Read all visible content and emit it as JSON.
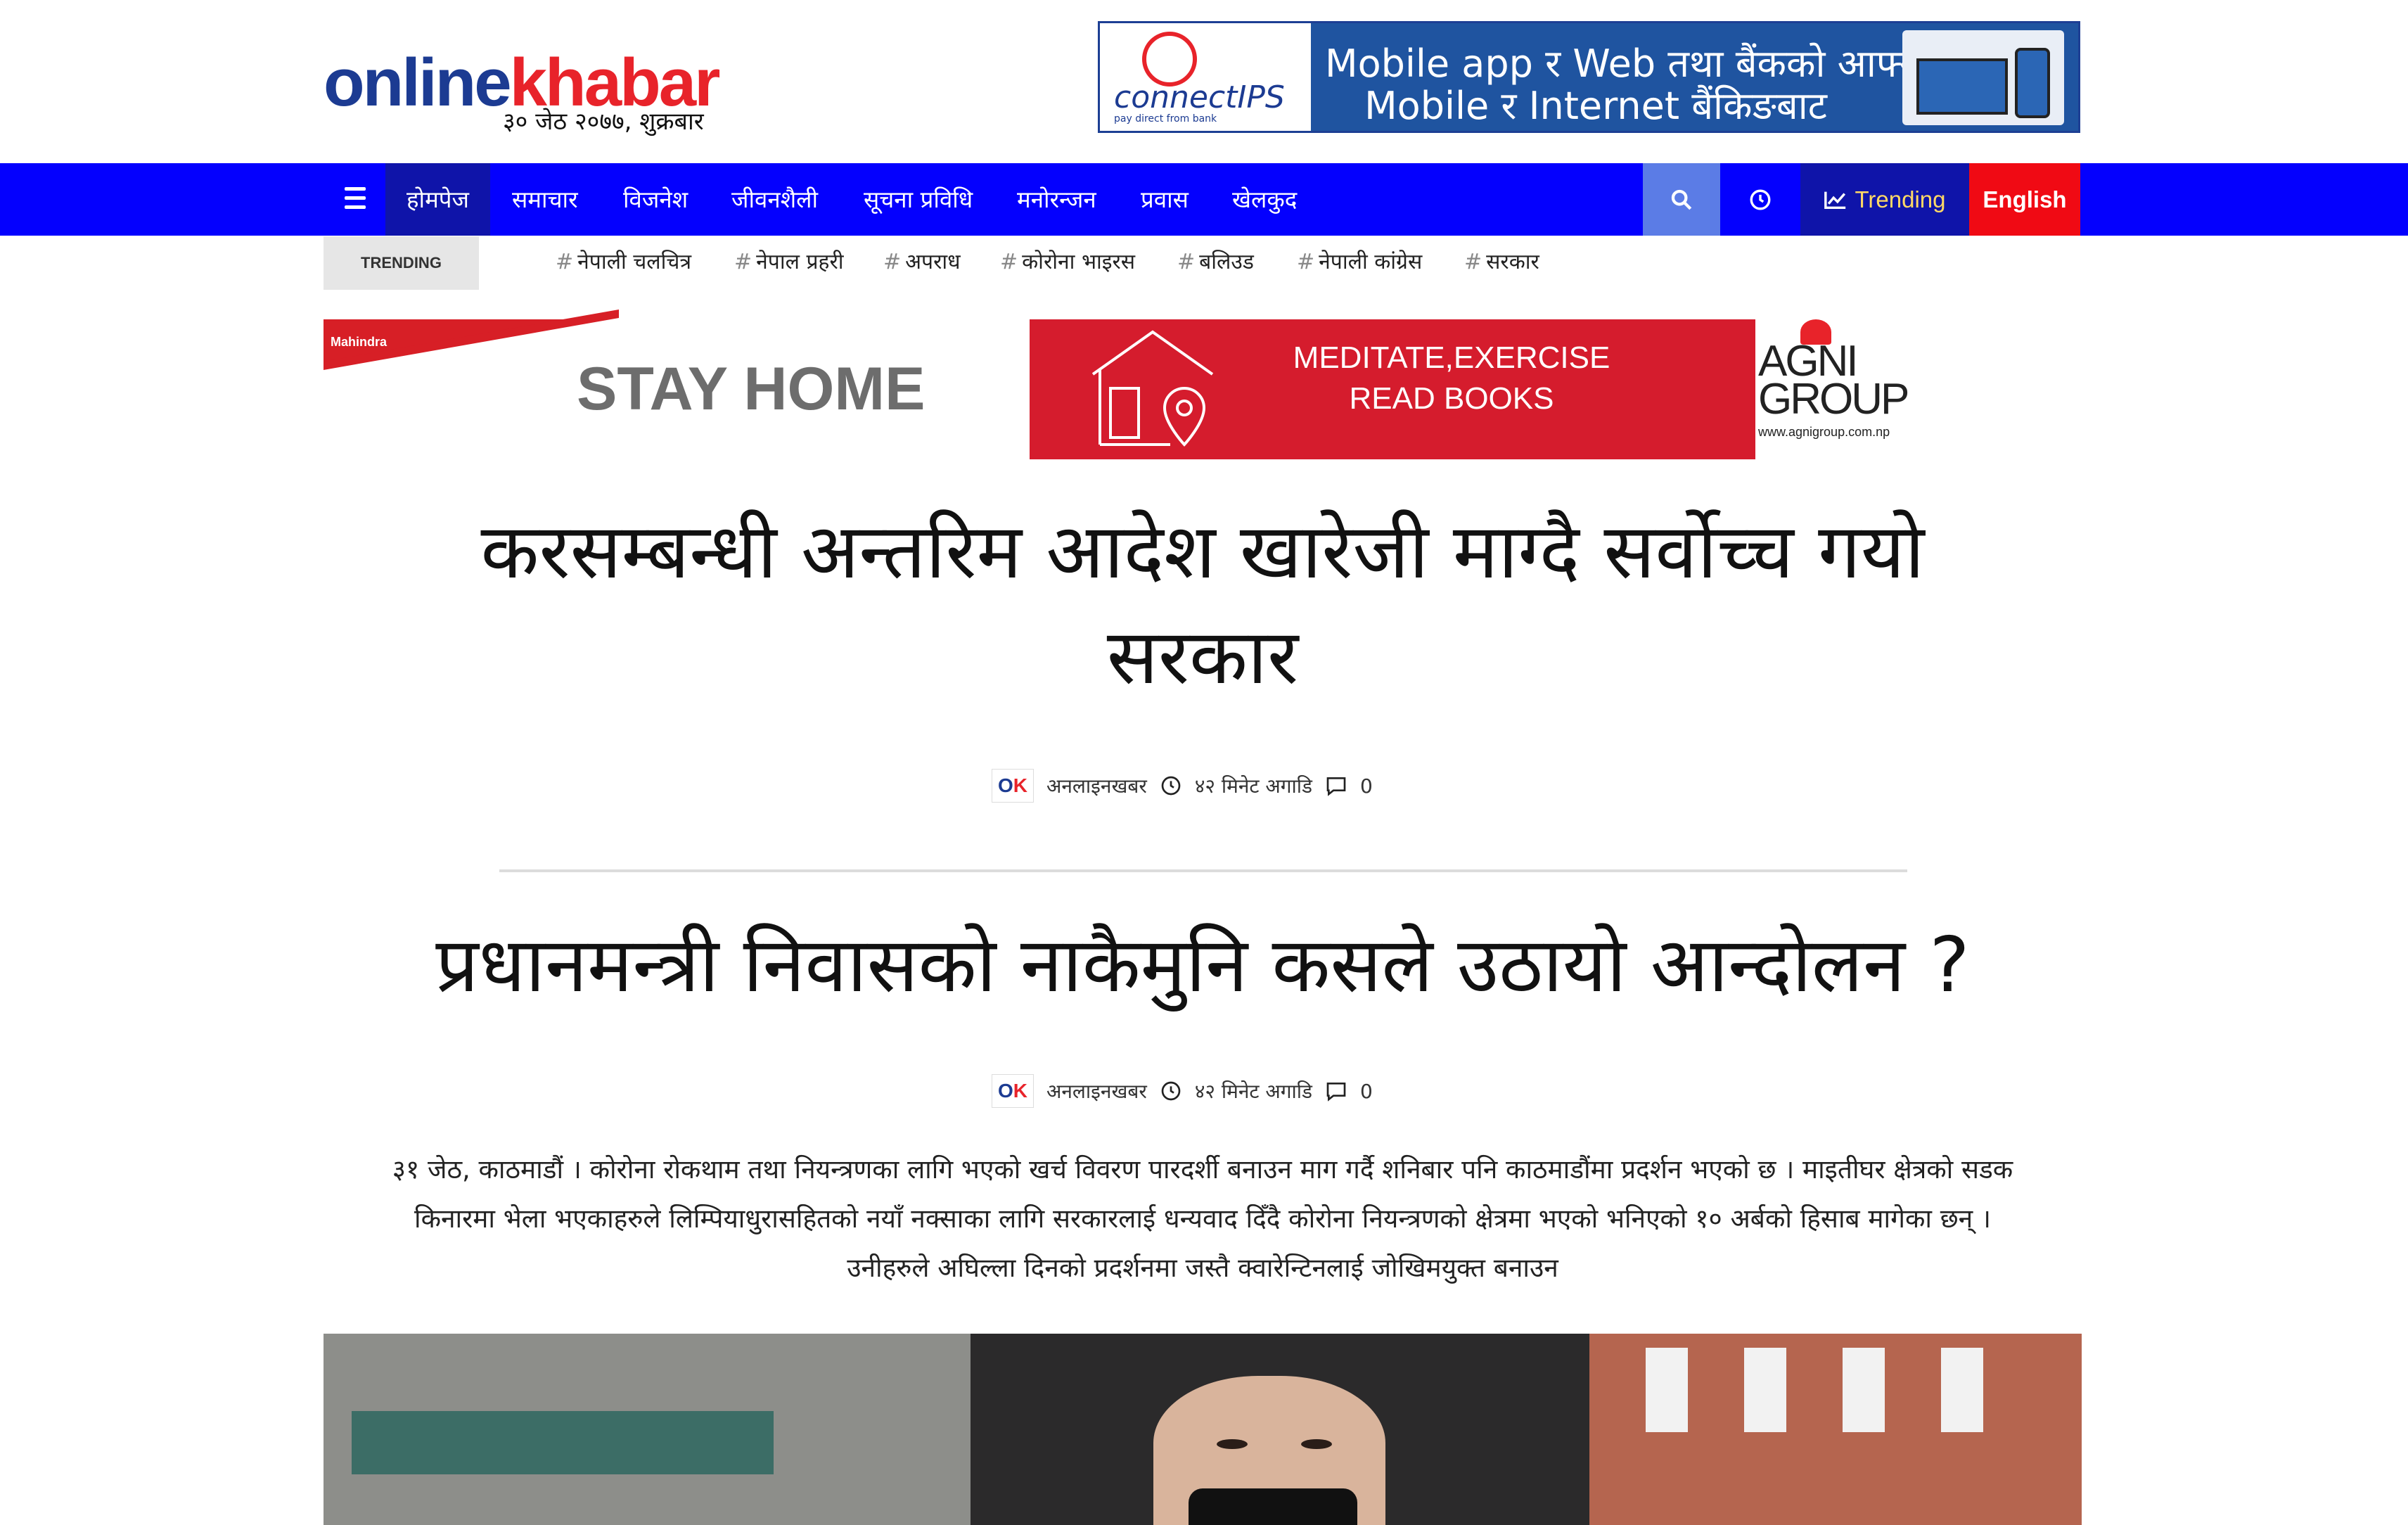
{
  "header": {
    "logo_part1": "online",
    "logo_part2": "khabar",
    "date": "३० जेठ २०७७, शुक्रबार",
    "top_ad": {
      "brand": "connectIPS",
      "brand_sub": "pay direct from bank",
      "line1": "Mobile app र Web तथा बैंकको आफ्नो",
      "line2": "Mobile र Internet बैंकिङबाट"
    }
  },
  "nav": {
    "items": [
      "होमपेज",
      "समाचार",
      "विजनेश",
      "जीवनशैली",
      "सूचना प्रविधि",
      "मनोरन्जन",
      "प्रवास",
      "खेलकुद"
    ],
    "trending_label": "Trending",
    "english_label": "English"
  },
  "trending_bar": {
    "label": "TRENDING",
    "tags": [
      "नेपाली चलचित्र",
      "नेपाल प्रहरी",
      "अपराध",
      "कोरोना भाइरस",
      "बलिउड",
      "नेपाली कांग्रेस",
      "सरकार"
    ]
  },
  "banner_ad": {
    "mahindra": "Mahindra",
    "stay_home": "STAY HOME",
    "line1": "MEDITATE,EXERCISE",
    "line2": "READ BOOKS",
    "agni1": "AGNI",
    "agni2": "GROUP",
    "agni_url": "www.agnigroup.com.np"
  },
  "articles": [
    {
      "title_line1": "करसम्बन्धी अन्तरिम आदेश खारेजी माग्दै सर्वोच्च गयो",
      "title_line2": "सरकार",
      "author": "अनलाइनखबर",
      "time": "४२ मिनेट अगाडि",
      "comments": "0"
    },
    {
      "title_line1": "प्रधानमन्त्री निवासको नाकैमुनि कसले उठायो आन्दोलन ?",
      "author": "अनलाइनखबर",
      "time": "४२ मिनेट अगाडि",
      "comments": "0",
      "summary_line1": "३१ जेठ, काठमाडौं । कोरोना रोकथाम तथा नियन्त्रणका लागि भएको खर्च विवरण पारदर्शी बनाउन माग गर्दै शनिबार पनि काठमाडौंमा प्रदर्शन भएको छ । माइतीघर क्षेत्रको सडक",
      "summary_line2": "किनारमा भेला भएकाहरुले लिम्पियाधुरासहितको नयाँ नक्साका लागि सरकारलाई धन्यवाद दिँदै कोरोना नियन्त्रणको क्षेत्रमा भएको भनिएको १० अर्बको हिसाब मागेका छन् ।",
      "summary_line3": "उनीहरुले अघिल्ला दिनको प्रदर्शनमा जस्तै क्वारेन्टिनलाई जोखिमयुक्त बनाउन"
    }
  ],
  "colors": {
    "nav_bg": "#0400fe",
    "nav_active": "#0f14a9",
    "english_bg": "#f00a14",
    "logo_blue": "#1c3b92",
    "logo_red": "#e8232a"
  }
}
